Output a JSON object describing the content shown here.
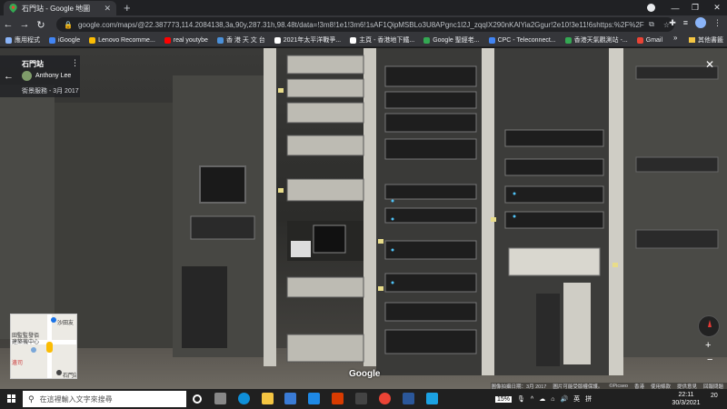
{
  "browser": {
    "tab_title": "石門站 - Google 地圖",
    "url": "google.com/maps/@22.387773,114.2084138,3a,90y,287.31h,98.48t/data=!3m8!1e1!3m6!1sAF1QipMSBLo3U8APgnc1l2J_zqqIX290nKAlYia2Ggur!2e10!3e11!6shttps:%2F%2Flh5.googl...",
    "bookmarks": [
      {
        "label": "應用程式",
        "color": "#8ab4f8"
      },
      {
        "label": "iGoogle",
        "color": "#4285f4"
      },
      {
        "label": "Lenovo Recomme...",
        "color": "#fbbc04"
      },
      {
        "label": "real youtybe",
        "color": "#ff0000"
      },
      {
        "label": "香 港 天 文 台",
        "color": "#4a90d9"
      },
      {
        "label": "2021年太平洋戰爭...",
        "color": "#ffffff"
      },
      {
        "label": "主頁 - 香港地下鐵...",
        "color": "#ffffff"
      },
      {
        "label": "Google 聖經老...",
        "color": "#34a853"
      },
      {
        "label": "CPC - Teleconnect...",
        "color": "#4285f4"
      },
      {
        "label": "香港天氣觀測站 -...",
        "color": "#34a853"
      },
      {
        "label": "Gmail",
        "color": "#ea4335"
      }
    ],
    "bookmarks_more": "»",
    "bookmarks_other": "其他書籤"
  },
  "streetview": {
    "place_name": "石門站",
    "author": "Anthony Lee",
    "capture_date": "街景服務 - 3月 2017",
    "logo": "Google",
    "attribution": [
      "圖像拍攝日期：3月 2017",
      "圖片可能受版權保護。",
      "©Picseo",
      "香港",
      "使用條款",
      "提供意見",
      "回報問題"
    ],
    "minimap": {
      "labels": [
        "沙田友",
        "田監監發佰",
        "建築機中心",
        "邊司",
        "石門站"
      ]
    }
  },
  "taskbar": {
    "search_placeholder": "在這裡輸入文字來搜尋",
    "battery": "15%",
    "ime": "英",
    "ime2": "拼",
    "time": "22:11",
    "date": "30/3/2021",
    "notification_count": "20"
  }
}
